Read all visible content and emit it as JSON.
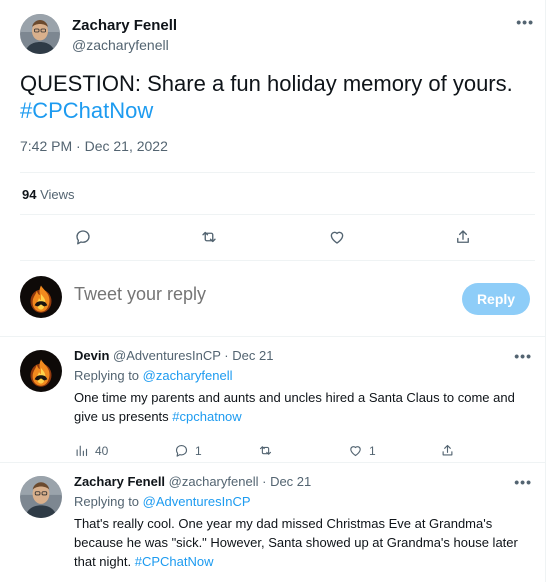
{
  "tweet": {
    "author_name": "Zachary Fenell",
    "author_handle": "@zacharyfenell",
    "text_main": "QUESTION: Share a fun holiday memory of yours.",
    "hashtag": "#CPChatNow",
    "timestamp": "7:42 PM · Dec 21, 2022",
    "views_count": "94",
    "views_label": "Views"
  },
  "composer": {
    "placeholder": "Tweet your reply",
    "reply_button": "Reply"
  },
  "replies": [
    {
      "name": "Devin",
      "handle": "@AdventuresInCP",
      "date": "Dec 21",
      "replying_prefix": "Replying to",
      "replying_to": "@zacharyfenell",
      "text": "One time my parents and aunts and uncles hired a Santa Claus to come and give us presents",
      "hashtag": "#cpchatnow",
      "views": "40",
      "replies_count": "1",
      "likes_count": "1"
    },
    {
      "name": "Zachary Fenell",
      "handle": "@zacharyfenell",
      "date": "Dec 21",
      "replying_prefix": "Replying to",
      "replying_to": "@AdventuresInCP",
      "text": "That's really cool. One year my dad missed Christmas Eve at Grandma's because he was \"sick.\" However, Santa showed up at Grandma's house later that night.",
      "hashtag": "#CPChatNow"
    }
  ],
  "icons": {
    "more": "more-icon",
    "reply": "reply-icon",
    "retweet": "retweet-icon",
    "like": "like-icon",
    "share": "share-icon",
    "analytics": "analytics-icon"
  },
  "colors": {
    "accent": "#1d9bf0",
    "reply_button": "#8ecdf8",
    "secondary_text": "#536471",
    "divider": "#eff3f4"
  }
}
